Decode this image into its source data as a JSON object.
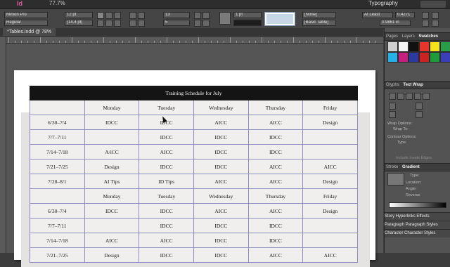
{
  "app": {
    "logo": "Id",
    "zoom": "77.7%",
    "workspace": "Typography"
  },
  "control_panel": {
    "font_family": "Minion Pro",
    "font_style": "Regular",
    "font_size": "12 pt",
    "leading": "(14.4 pt)",
    "rows": "13",
    "columns": "5",
    "stroke_weight": "1 pt",
    "cell_style": "[None]",
    "table_style": "[Basic Table]",
    "row_height_mode": "At Least",
    "row_height": "0.4271",
    "column_width": "0.9861 in"
  },
  "document": {
    "tab_label": "*Tables.indd @ 78%"
  },
  "table": {
    "title": "Training Schedule for July",
    "rows": [
      [
        "",
        "Monday",
        "Tuesday",
        "Wednesday",
        "Thursday",
        "Friday"
      ],
      [
        "6/30–7/4",
        "IDCC",
        "IDCC",
        "AICC",
        "AICC",
        "Design"
      ],
      [
        "7/7–7/11",
        "",
        "IDCC",
        "IDCC",
        "IDCC",
        ""
      ],
      [
        "7/14–7/18",
        "A/iCC",
        "AICC",
        "IDCC",
        "IDCC",
        ""
      ],
      [
        "7/21–7/25",
        "Design",
        "IDCC",
        "IDCC",
        "AICC",
        "AICC"
      ],
      [
        "7/28–8/1",
        "AI Tips",
        "ID Tips",
        "AICC",
        "AICC",
        "Design"
      ],
      [
        "",
        "Monday",
        "Tuesday",
        "Wednesday",
        "Thursday",
        "Friday"
      ],
      [
        "6/30–7/4",
        "IDCC",
        "IDCC",
        "AICC",
        "AICC",
        "Design"
      ],
      [
        "7/7–7/11",
        "",
        "IDCC",
        "IDCC",
        "IDCC",
        ""
      ],
      [
        "7/14–7/18",
        "AICC",
        "AICC",
        "IDCC",
        "IDCC",
        ""
      ],
      [
        "7/21–7/25",
        "Design",
        "IDCC",
        "IDCC",
        "AICC",
        "AICC"
      ]
    ]
  },
  "panels": {
    "swatches_tabs": [
      "Pages",
      "Layers",
      "Swatches"
    ],
    "swatch_colors": [
      "#d0d0d0",
      "#f4f4f4",
      "#111111",
      "#e8352c",
      "#f5e21b",
      "#2a9d48",
      "#27b0e6",
      "#c51f7f",
      "#2b3aa0",
      "#cc2222",
      "#1e9b3a",
      "#3a3fb7"
    ],
    "text_wrap_tabs": [
      "Glyphs",
      "Text Wrap"
    ],
    "wrap_options_label": "Wrap Options:",
    "wrap_to_label": "Wrap To:",
    "contour_options_label": "Contour Options:",
    "contour_type_label": "Type:",
    "include_inside_edges": "Include Inside Edges",
    "stroke_tabs": [
      "Stroke",
      "Gradient"
    ],
    "gradient_type_label": "Type:",
    "gradient_location_label": "Location:",
    "gradient_angle_label": "Angle:",
    "gradient_reverse_label": "Reverse",
    "story_tabs": [
      "Story",
      "Hyperlinks",
      "Effects"
    ],
    "paragraph_tabs": [
      "Paragraph",
      "Paragraph Styles"
    ],
    "character_tabs": [
      "Character",
      "Character Styles"
    ]
  }
}
